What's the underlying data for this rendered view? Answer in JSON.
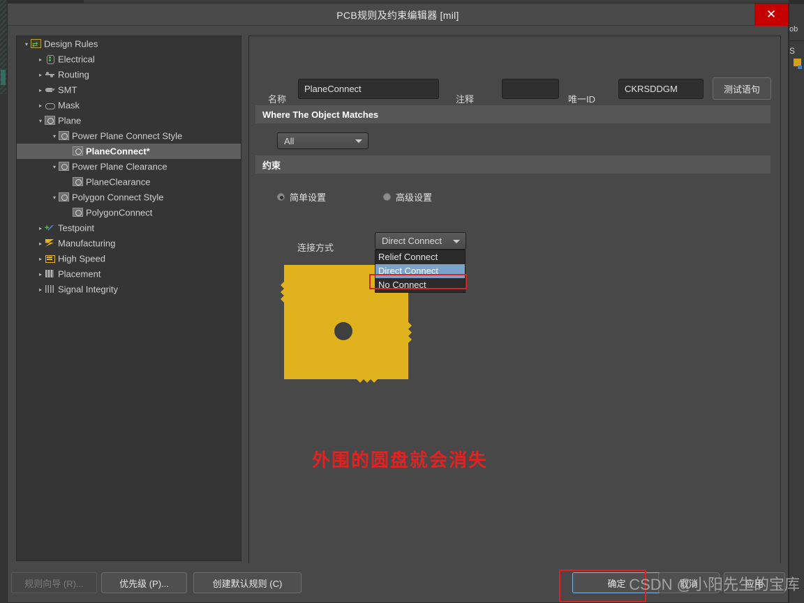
{
  "window": {
    "title": "PCB规则及约束编辑器 [mil]",
    "close_label": "×"
  },
  "background": {
    "right_tab_label_1": "ob",
    "right_tab_label_2": "S"
  },
  "tree": {
    "items": [
      {
        "label": "Design Rules",
        "depth": 0,
        "twisty": "expanded",
        "icon": "design-rules-icon",
        "selected": false
      },
      {
        "label": "Electrical",
        "depth": 1,
        "twisty": "collapsed",
        "icon": "electrical-icon",
        "selected": false
      },
      {
        "label": "Routing",
        "depth": 1,
        "twisty": "collapsed",
        "icon": "routing-icon",
        "selected": false
      },
      {
        "label": "SMT",
        "depth": 1,
        "twisty": "collapsed",
        "icon": "smt-icon",
        "selected": false
      },
      {
        "label": "Mask",
        "depth": 1,
        "twisty": "collapsed",
        "icon": "mask-icon",
        "selected": false
      },
      {
        "label": "Plane",
        "depth": 1,
        "twisty": "expanded",
        "icon": "plane-icon",
        "selected": false
      },
      {
        "label": "Power Plane Connect Style",
        "depth": 2,
        "twisty": "expanded",
        "icon": "plane-icon",
        "selected": false
      },
      {
        "label": "PlaneConnect*",
        "depth": 3,
        "twisty": "none",
        "icon": "plane-icon",
        "selected": true
      },
      {
        "label": "Power Plane Clearance",
        "depth": 2,
        "twisty": "expanded",
        "icon": "plane-icon",
        "selected": false
      },
      {
        "label": "PlaneClearance",
        "depth": 3,
        "twisty": "none",
        "icon": "plane-icon",
        "selected": false
      },
      {
        "label": "Polygon Connect Style",
        "depth": 2,
        "twisty": "expanded",
        "icon": "plane-icon",
        "selected": false
      },
      {
        "label": "PolygonConnect",
        "depth": 3,
        "twisty": "none",
        "icon": "plane-icon",
        "selected": false
      },
      {
        "label": "Testpoint",
        "depth": 1,
        "twisty": "collapsed",
        "icon": "testpoint-icon",
        "selected": false
      },
      {
        "label": "Manufacturing",
        "depth": 1,
        "twisty": "collapsed",
        "icon": "manufacturing-icon",
        "selected": false
      },
      {
        "label": "High Speed",
        "depth": 1,
        "twisty": "collapsed",
        "icon": "high-speed-icon",
        "selected": false
      },
      {
        "label": "Placement",
        "depth": 1,
        "twisty": "collapsed",
        "icon": "placement-icon",
        "selected": false
      },
      {
        "label": "Signal Integrity",
        "depth": 1,
        "twisty": "collapsed",
        "icon": "signal-integrity-icon",
        "selected": false
      }
    ]
  },
  "form": {
    "name_label": "名称",
    "name_value": "PlaneConnect",
    "comment_label": "注释",
    "comment_value": "",
    "unique_id_label": "唯一ID",
    "unique_id_value": "CKRSDDGM",
    "test_query_button": "测试语句"
  },
  "where_section": {
    "header": "Where The Object Matches",
    "scope_value": "All"
  },
  "constraints_section": {
    "header": "约束",
    "radio_simple": "简单设置",
    "radio_advanced": "高级设置",
    "radio_selected": "simple",
    "connect_style_label": "连接方式",
    "connect_style_value": "Direct Connect",
    "dropdown_options": [
      "Relief Connect",
      "Direct Connect",
      "No Connect"
    ],
    "dropdown_selected_index": 1,
    "annotation": "外围的圆盘就会消失"
  },
  "colors": {
    "accent_yellow": "#e0b21e",
    "highlight_red": "#e02020",
    "selection_blue": "#7ba3c9",
    "close_red": "#c40000"
  },
  "footer": {
    "rule_wizard": "规则向导 (R)...",
    "priority": "优先级 (P)...",
    "create_default_rules": "创建默认规则 (C)",
    "ok": "确定",
    "cancel": "取消",
    "apply": "应用"
  },
  "watermark": {
    "text": "CSDN @小阳先生的宝库"
  }
}
